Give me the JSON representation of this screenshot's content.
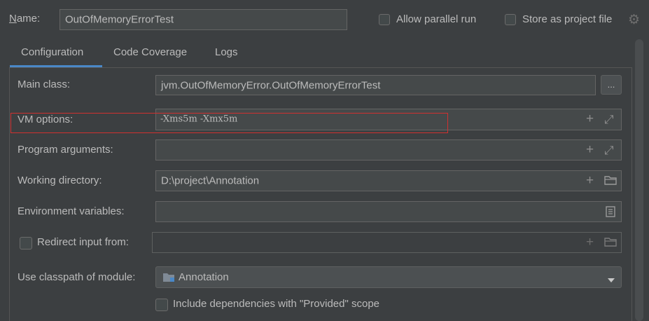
{
  "header": {
    "name_label": "Name:",
    "name_label_mnemonic": "N",
    "name_label_rest": "ame:",
    "name_value": "OutOfMemoryErrorTest",
    "allow_parallel_label": "Allow parallel run",
    "store_project_file_label": "Store as project file"
  },
  "tabs": [
    {
      "label": "Configuration",
      "active": true
    },
    {
      "label": "Code Coverage",
      "active": false
    },
    {
      "label": "Logs",
      "active": false
    }
  ],
  "form": {
    "main_class": {
      "label": "Main class:",
      "value": "jvm.OutOfMemoryError.OutOfMemoryErrorTest",
      "browse": "..."
    },
    "vm_options": {
      "label": "VM options:",
      "value": "-Xms5m -Xmx5m"
    },
    "program_arguments": {
      "label": "Program arguments:",
      "value": ""
    },
    "working_directory": {
      "label": "Working directory:",
      "value": "D:\\project\\Annotation"
    },
    "environment_variables": {
      "label": "Environment variables:",
      "value": ""
    },
    "redirect_input": {
      "label": "Redirect input from:",
      "value": ""
    },
    "classpath_module": {
      "label": "Use classpath of module:",
      "value": "Annotation"
    },
    "include_provided": {
      "label": "Include dependencies with \"Provided\" scope"
    }
  },
  "colors": {
    "background": "#3c3f41",
    "field": "#45494a",
    "accent": "#4a88c7",
    "highlight": "#d03030"
  }
}
